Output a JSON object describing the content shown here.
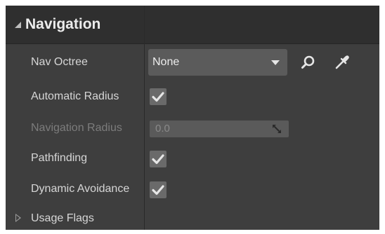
{
  "section": {
    "title": "Navigation"
  },
  "rows": {
    "nav_octree": {
      "label": "Nav Octree",
      "value": "None",
      "icons": [
        "search-icon",
        "eyedropper-icon"
      ]
    },
    "automatic_radius": {
      "label": "Automatic Radius",
      "checked": true
    },
    "navigation_radius": {
      "label": "Navigation Radius",
      "value": "0.0",
      "disabled": true
    },
    "pathfinding": {
      "label": "Pathfinding",
      "checked": true
    },
    "dynamic_avoidance": {
      "label": "Dynamic Avoidance",
      "checked": true
    },
    "usage_flags": {
      "label": "Usage Flags",
      "expanded": false
    }
  },
  "colors": {
    "panel_bg": "#3e3e3e",
    "header_bg": "#2f2f2f",
    "text": "#d6d6d6",
    "disabled_text": "#7c7c7c",
    "field_bg": "#5b5b5b",
    "checkmark": "#e6e6e6"
  }
}
